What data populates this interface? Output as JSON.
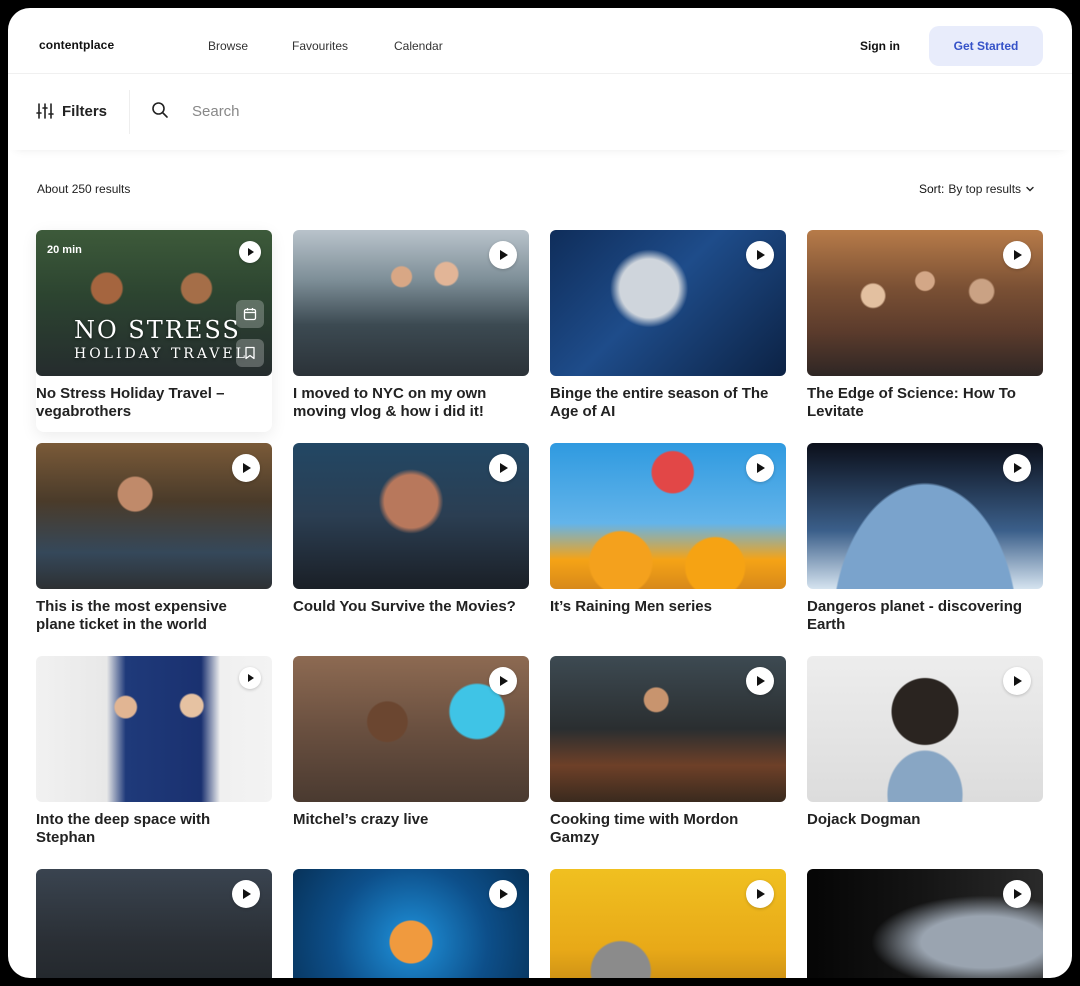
{
  "app": {
    "logo": "contentplace"
  },
  "nav": {
    "links": [
      "Browse",
      "Favourites",
      "Calendar"
    ],
    "sign_in": "Sign in",
    "get_started": "Get Started"
  },
  "filterbar": {
    "filters_label": "Filters",
    "search_placeholder": "Search"
  },
  "results": {
    "count": "About 250 results",
    "sort_label": "Sort:",
    "sort_value": "By top results"
  },
  "cards": [
    {
      "title": "No Stress Holiday Travel – vegabrothers",
      "duration": "20 min",
      "overlay_line1": "NO STRESS",
      "overlay_line2": "HOLIDAY TRAVEL"
    },
    {
      "title": "I moved to NYC on my own moving vlog & how i did it!"
    },
    {
      "title": "Binge the entire season of The Age of AI"
    },
    {
      "title": "The Edge of Science: How To Levitate"
    },
    {
      "title": "This is the most expensive plane ticket in the world"
    },
    {
      "title": "Could You Survive the Movies?"
    },
    {
      "title": "It’s Raining Men series"
    },
    {
      "title": "Dangeros planet - discovering Earth"
    },
    {
      "title": "Into the deep space with Stephan"
    },
    {
      "title": "Mitchel’s crazy live"
    },
    {
      "title": "Cooking time with Mordon Gamzy"
    },
    {
      "title": "Dojack Dogman"
    },
    {
      "title": ""
    },
    {
      "title": ""
    },
    {
      "title": ""
    },
    {
      "title": ""
    }
  ]
}
